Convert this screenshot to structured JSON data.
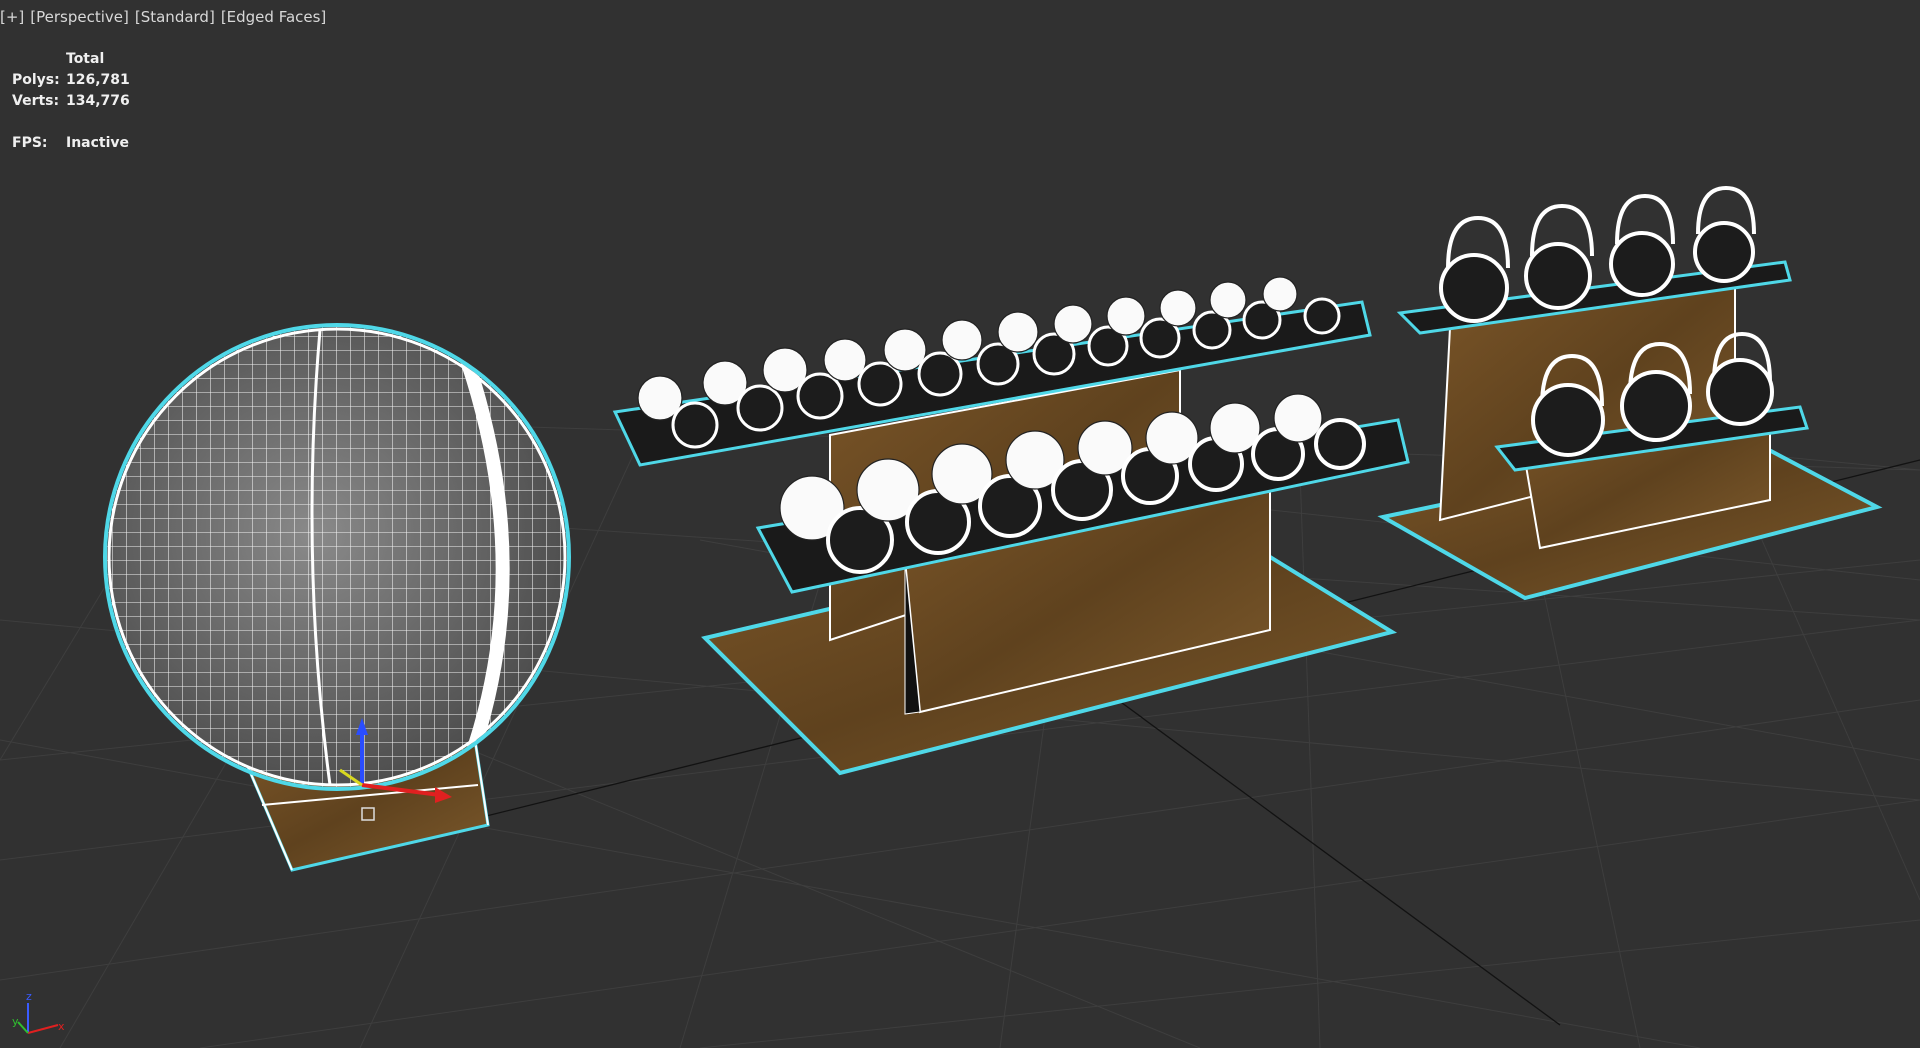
{
  "viewport": {
    "label_plus": "[+]",
    "label_view": "[Perspective]",
    "label_shading": "[Standard]",
    "label_edges": "[Edged Faces]"
  },
  "stats": {
    "header": "Total",
    "polys_label": "Polys:",
    "polys_value": "126,781",
    "verts_label": "Verts:",
    "verts_value": "134,776",
    "fps_label": "FPS:",
    "fps_value": "Inactive"
  },
  "colors": {
    "background": "#313131",
    "grid": "#3d3d3d",
    "selection": "#4fd8e8",
    "wood": "#6b4a22",
    "wireframe": "#ffffff"
  },
  "icons": {
    "world_axis": "xyz-axis-icon",
    "gizmo": "move-gizmo-icon"
  }
}
